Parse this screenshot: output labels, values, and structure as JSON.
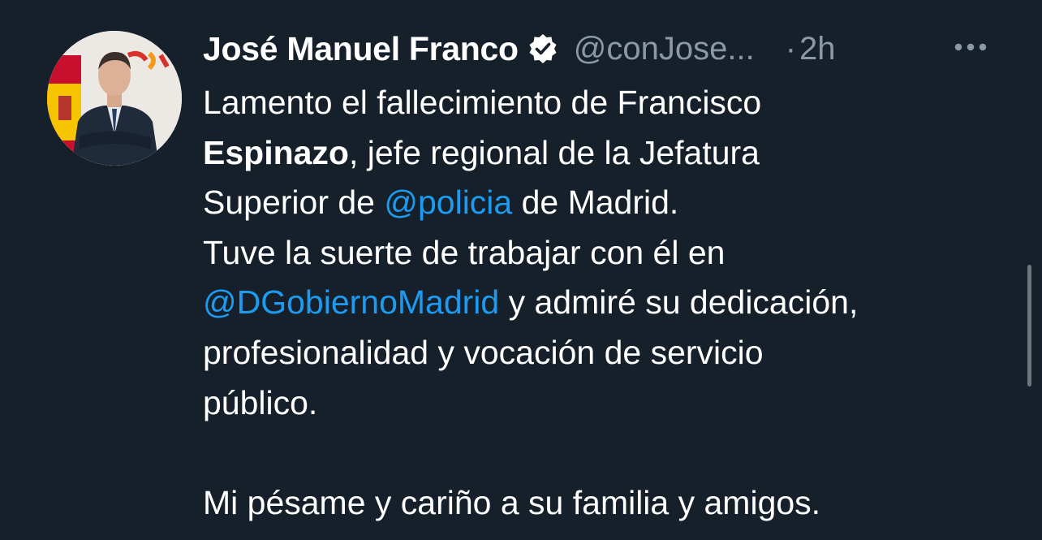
{
  "author": {
    "name": "José Manuel Franco",
    "handle": "@conJose...",
    "separator": "·",
    "time": "2h",
    "verified_icon": "verified-badge-icon"
  },
  "more_icon": "more-horizontal-icon",
  "tweet": {
    "line1": "Lamento el fallecimiento de Francisco",
    "line2_bold": "Espinazo",
    "line2_rest": ", jefe regional de la Jefatura",
    "line3_a": "Superior de ",
    "line3_mention": "@policia",
    "line3_b": " de Madrid.",
    "line4": "Tuve la suerte de trabajar con él en",
    "line5_mention": "@DGobiernoMadrid",
    "line5_rest": " y admiré su dedicación,",
    "line6": "profesionalidad y vocación de servicio",
    "line7": "público.",
    "line8": "Mi pésame y cariño a su familia y amigos."
  },
  "colors": {
    "background": "#15202b",
    "text": "#ffffff",
    "secondary": "#8b98a5",
    "link": "#1d9bf0"
  }
}
